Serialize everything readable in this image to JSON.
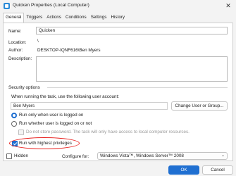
{
  "window": {
    "title": "Quicken Properties (Local Computer)",
    "close_glyph": "✕"
  },
  "tabs": [
    {
      "label": "General"
    },
    {
      "label": "Triggers"
    },
    {
      "label": "Actions"
    },
    {
      "label": "Conditions"
    },
    {
      "label": "Settings"
    },
    {
      "label": "History"
    }
  ],
  "general": {
    "name_label": "Name:",
    "name_value": "Quicken",
    "location_label": "Location:",
    "location_value": "\\",
    "author_label": "Author:",
    "author_value": "DESKTOP-IQNF616\\Ben Myers",
    "description_label": "Description:",
    "description_value": ""
  },
  "security": {
    "section_label": "Security options",
    "account_prompt": "When running the task, use the following user account:",
    "account_value": "Ben Myers",
    "change_user_button": "Change User or Group...",
    "radio_logged_on": "Run only when user is logged on",
    "radio_whether": "Run whether user is logged on or not",
    "do_not_store": "Do not store password.  The task will only have access to local computer resources.",
    "highest_privileges": "Run with highest privileges"
  },
  "footer": {
    "hidden_label": "Hidden",
    "configure_label": "Configure for:",
    "configure_value": "Windows Vista™, Windows Server™ 2008",
    "ok_button": "OK",
    "cancel_button": "Cancel"
  },
  "colors": {
    "accent": "#1f6fd1",
    "highlight_circle": "#e8201e"
  },
  "icons": {
    "window_icon": "task-scheduler-icon",
    "close_icon": "close-icon",
    "dropdown_icon": "chevron-down-icon"
  }
}
